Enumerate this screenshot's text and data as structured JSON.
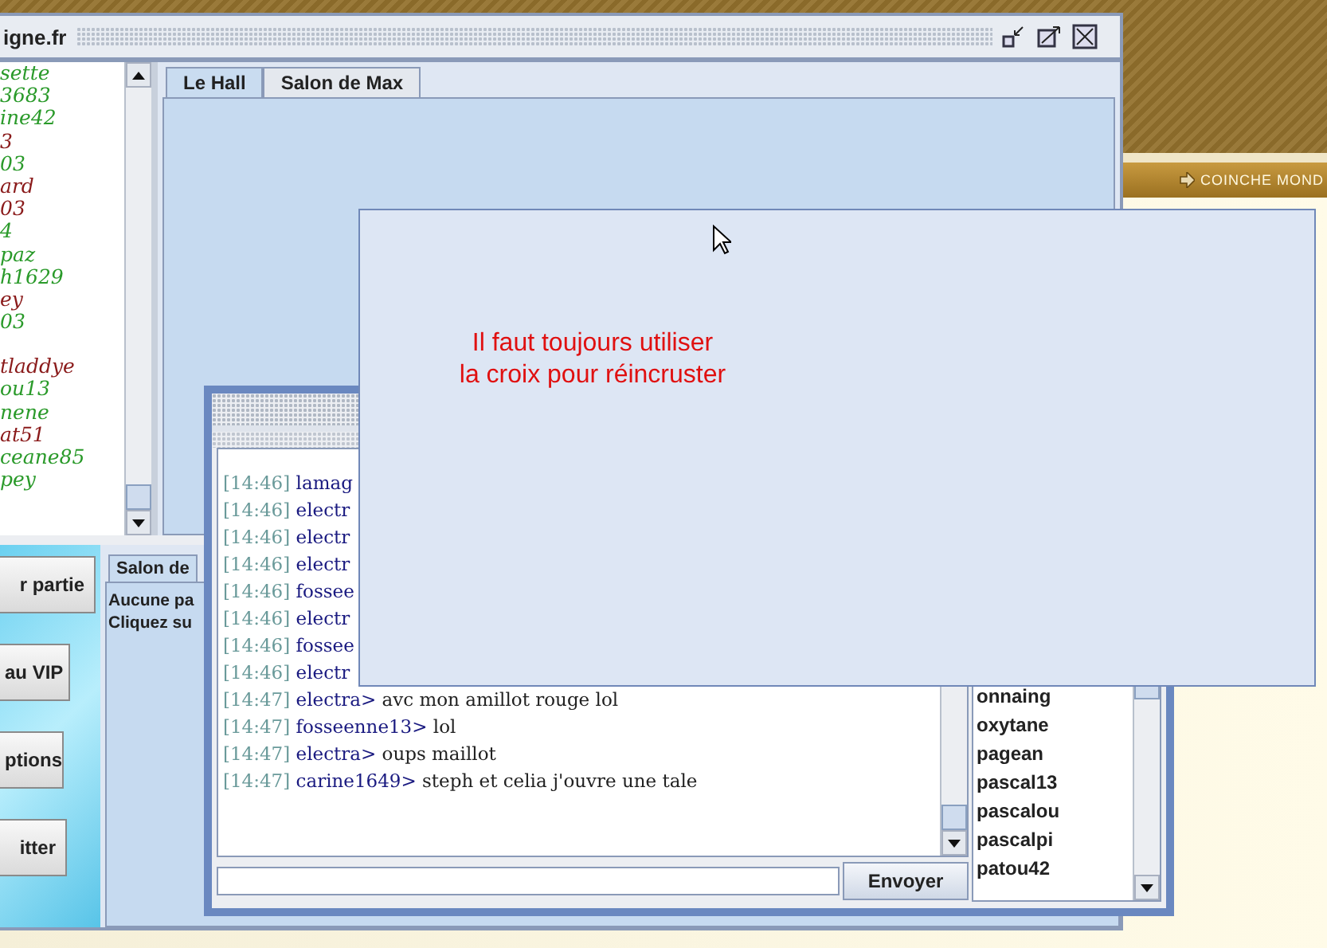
{
  "site": {
    "nav_link": "COINCHE MOND"
  },
  "main_window": {
    "title": "igne.fr",
    "players": [
      {
        "name": "sette",
        "color": "#2a9a2a"
      },
      {
        "name": "3683",
        "color": "#2a9a2a"
      },
      {
        "name": "ine42",
        "color": "#2a9a2a"
      },
      {
        "name": "3",
        "color": "#8a1a1a"
      },
      {
        "name": "03",
        "color": "#2a9a2a"
      },
      {
        "name": "ard",
        "color": "#8a1a1a"
      },
      {
        "name": "03",
        "color": "#8a1a1a"
      },
      {
        "name": "4",
        "color": "#2a9a2a"
      },
      {
        "name": "paz",
        "color": "#2a9a2a"
      },
      {
        "name": "h1629",
        "color": "#2a9a2a"
      },
      {
        "name": "ey",
        "color": "#8a1a1a"
      },
      {
        "name": "03",
        "color": "#2a9a2a"
      },
      {
        "name": "tladdye",
        "color": "#8a1a1a"
      },
      {
        "name": "ou13",
        "color": "#2a9a2a"
      },
      {
        "name": "nene",
        "color": "#2a9a2a"
      },
      {
        "name": "at51",
        "color": "#8a1a1a"
      },
      {
        "name": "ceane85",
        "color": "#2a9a2a"
      },
      {
        "name": "pey",
        "color": "#2a9a2a"
      }
    ],
    "tabs": [
      {
        "label": "Le Hall",
        "selected": true
      },
      {
        "label": "Salon de Max",
        "selected": false
      }
    ],
    "side_buttons": [
      "r partie",
      "au VIP",
      "ptions",
      "itter"
    ],
    "lower_tabs": [
      {
        "label": "Salon de",
        "selected": true
      }
    ],
    "lower_text": [
      "Aucune pa",
      "Cliquez su"
    ]
  },
  "chat_window": {
    "messages": [
      {
        "time": "[14:46]",
        "user": "lamag"
      },
      {
        "time": "[14:46]",
        "user": "electr"
      },
      {
        "time": "[14:46]",
        "user": "electr"
      },
      {
        "time": "[14:46]",
        "user": "electr"
      },
      {
        "time": "[14:46]",
        "user": "fossee"
      },
      {
        "time": "[14:46]",
        "user": "electr"
      },
      {
        "time": "[14:46]",
        "user": "fossee"
      },
      {
        "time": "[14:46]",
        "user": "electr"
      },
      {
        "time": "[14:47]",
        "user": "electra>",
        "text": "avc mon amillot rouge lol"
      },
      {
        "time": "[14:47]",
        "user": "fosseenne13>",
        "text": "lol"
      },
      {
        "time": "[14:47]",
        "user": "electra>",
        "text": "oups maillot"
      },
      {
        "time": "[14:47]",
        "user": "carine1649>",
        "text": "steph et celia j'ouvre une tale"
      }
    ],
    "send_button": "Envoyer",
    "users": [
      "onnaing",
      "oxytane",
      "pagean",
      "pascal13",
      "pascalou",
      "pascalpi",
      "patou42"
    ]
  },
  "notice": {
    "lines": [
      "Il faut toujours utiliser",
      "la croix pour réincruster"
    ]
  }
}
